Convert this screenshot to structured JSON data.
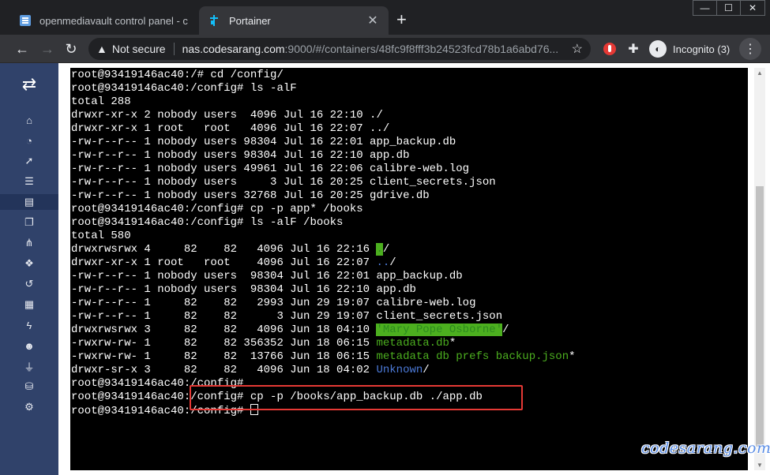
{
  "tabs": [
    {
      "title": "openmediavault control panel - c",
      "active": false
    },
    {
      "title": "Portainer",
      "active": true
    }
  ],
  "window_controls": [
    "minimize",
    "maximize",
    "close"
  ],
  "address_bar": {
    "security_label": "Not secure",
    "host": "nas.codesarang.com",
    "path": ":9000/#/containers/48fc9f8fff3b24523fcd78b1a6abd76..."
  },
  "profile": {
    "label": "Incognito (3)"
  },
  "sidebar": {
    "items": [
      {
        "icon": "home-icon",
        "glyph": "⌂"
      },
      {
        "icon": "dashboard-icon",
        "glyph": "◔"
      },
      {
        "icon": "rocket-icon",
        "glyph": "➚"
      },
      {
        "icon": "th-list-icon",
        "glyph": "☰"
      },
      {
        "icon": "server-icon",
        "glyph": "▤",
        "active": true
      },
      {
        "icon": "clone-icon",
        "glyph": "❐"
      },
      {
        "icon": "sitemap-icon",
        "glyph": "⋔"
      },
      {
        "icon": "cubes-icon",
        "glyph": "❖"
      },
      {
        "icon": "history-icon",
        "glyph": "↺"
      },
      {
        "icon": "th-icon",
        "glyph": "▦"
      },
      {
        "icon": "bolt-icon",
        "glyph": "ϟ"
      },
      {
        "icon": "users-icon",
        "glyph": "☻"
      },
      {
        "icon": "plug-icon",
        "glyph": "⏚"
      },
      {
        "icon": "database-icon",
        "glyph": "⛁"
      },
      {
        "icon": "cogs-icon",
        "glyph": "⚙"
      }
    ]
  },
  "terminal": {
    "lines": [
      "root@93419146ac40:/# cd /config/",
      "root@93419146ac40:/config# ls -alF",
      "total 288",
      "drwxr-xr-x 2 nobody users  4096 Jul 16 22:10 ./",
      "drwxr-xr-x 1 root   root   4096 Jul 16 22:07 ../",
      "-rw-r--r-- 1 nobody users 98304 Jul 16 22:01 app_backup.db",
      "-rw-r--r-- 1 nobody users 98304 Jul 16 22:10 app.db",
      "-rw-r--r-- 1 nobody users 49961 Jul 16 22:06 calibre-web.log",
      "-rw-r--r-- 1 nobody users     3 Jul 16 20:25 client_secrets.json",
      "-rw-r--r-- 1 nobody users 32768 Jul 16 20:25 gdrive.db",
      "root@93419146ac40:/config# cp -p app* /books",
      "root@93419146ac40:/config# ls -alF /books",
      "total 580"
    ],
    "listing": [
      {
        "meta": "drwxrwsrwx 4     82    82   4096 Jul 16 22:16 ",
        "name": ".",
        "suffix": "/",
        "style": "dir-hl"
      },
      {
        "meta": "drwxr-xr-x 1 root   root    4096 Jul 16 22:07 ",
        "name": "..",
        "suffix": "/",
        "style": "dir"
      },
      {
        "meta": "-rw-r--r-- 1 nobody users  98304 Jul 16 22:01 ",
        "name": "app_backup.db",
        "suffix": "",
        "style": "plain"
      },
      {
        "meta": "-rw-r--r-- 1 nobody users  98304 Jul 16 22:10 ",
        "name": "app.db",
        "suffix": "",
        "style": "plain"
      },
      {
        "meta": "-rw-r--r-- 1     82    82   2993 Jun 29 19:07 ",
        "name": "calibre-web.log",
        "suffix": "",
        "style": "plain"
      },
      {
        "meta": "-rw-r--r-- 1     82    82      3 Jun 29 19:07 ",
        "name": "client_secrets.json",
        "suffix": "",
        "style": "plain"
      },
      {
        "meta": "drwxrwsrwx 3     82    82   4096 Jun 18 04:10 ",
        "name": "'Mary Pope Osborne'",
        "suffix": "/",
        "style": "dir-hl"
      },
      {
        "meta": "-rwxrw-rw- 1     82    82 356352 Jun 18 06:15 ",
        "name": "metadata.db",
        "suffix": "*",
        "style": "exec"
      },
      {
        "meta": "-rwxrw-rw- 1     82    82  13766 Jun 18 06:15 ",
        "name": "metadata db prefs backup.json",
        "suffix": "*",
        "style": "exec"
      },
      {
        "meta": "drwxr-sr-x 3     82    82   4096 Jun 18 04:02 ",
        "name": "Unknown",
        "suffix": "/",
        "style": "dir"
      }
    ],
    "tail": [
      "root@93419146ac40:/config# ",
      "root@93419146ac40:/config# cp -p /books/app_backup.db ./app.db",
      "root@93419146ac40:/config# "
    ]
  },
  "colors": {
    "sidebar": "#30426a",
    "highlight_border": "#e53935",
    "exec": "#4caf1f",
    "dir": "#4c7ad8"
  },
  "watermark": "codesarang.com"
}
